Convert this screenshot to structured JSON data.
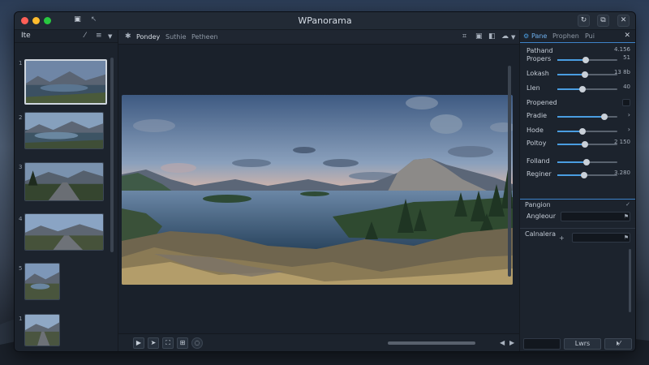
{
  "window": {
    "title": "WPanorama"
  },
  "colors": {
    "accent": "#4a9de0",
    "close": "#ff5f57",
    "minimize": "#febc2e",
    "zoom": "#28c840"
  },
  "titlebar": {
    "icons": [
      "square-icon",
      "back-arrow-icon",
      "refresh-icon",
      "copy-icon",
      "close-icon"
    ]
  },
  "sidebar": {
    "label": "Ite",
    "thumb_numbers": [
      "1",
      "2",
      "3",
      "4",
      "5",
      "1"
    ]
  },
  "toolbar": {
    "tabs": [
      "Pondey",
      "Suthie",
      "Petheen"
    ]
  },
  "panel": {
    "tabs": [
      "Pane",
      "Prophen",
      "Pui"
    ],
    "rows": [
      {
        "label": "Pathand",
        "value": "4.156",
        "fraction": null
      },
      {
        "label": "Propers",
        "value": "51",
        "fraction": 0.47
      },
      {
        "label": "Lokash",
        "value": "13 8b",
        "fraction": 0.46
      },
      {
        "label": "Llen",
        "value": "40",
        "fraction": 0.42
      },
      {
        "label": "Propened",
        "value": "",
        "fraction": null
      },
      {
        "label": "Pradie",
        "value": "",
        "fraction": 0.78
      },
      {
        "label": "Hode",
        "value": "",
        "fraction": 0.42
      },
      {
        "label": "Poltoy",
        "value": "2 150",
        "fraction": 0.46
      },
      {
        "label": "Folland",
        "value": "",
        "fraction": 0.48
      },
      {
        "label": "Reginer",
        "value": "3.280",
        "fraction": 0.45
      }
    ],
    "section1": "Pangion",
    "field1_label": "Angleour",
    "section2": "Calnalera",
    "button_apply": "Lwrs"
  }
}
